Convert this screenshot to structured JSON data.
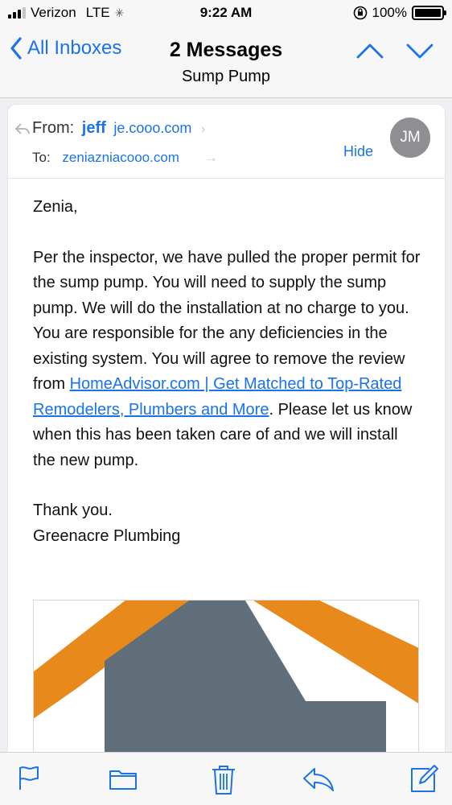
{
  "status_bar": {
    "carrier": "Verizon",
    "network": "LTE",
    "time": "9:22 AM",
    "battery": "100%"
  },
  "nav": {
    "back_label": "All Inboxes",
    "title": "2 Messages",
    "subtitle": "Sump Pump"
  },
  "message": {
    "from_label": "From:",
    "from_name": "jeff",
    "from_address": "je.cooo.com",
    "to_label": "To:",
    "to_address": "zeniazniacooo.com",
    "hide_label": "Hide",
    "avatar_initials": "JM",
    "greeting": "Zenia,",
    "body_part1": "Per the inspector, we have pulled the proper permit for the sump pump.  You will need to supply the sump pump.  We will do the installation at no charge to you.  You are responsible for the any deficiencies in the existing system.  You will agree to remove the review from ",
    "link_text": "HomeAdvisor.com | Get Matched to Top-Rated Remodelers, Plumbers and More",
    "body_part2": ". Please let us know when this has been taken care of and we will install the new pump.",
    "closing": "Thank you.",
    "signature": "Greenacre Plumbing"
  },
  "colors": {
    "accent": "#1a73e8",
    "logo_orange": "#e8891c",
    "logo_gray": "#5f6e78"
  }
}
